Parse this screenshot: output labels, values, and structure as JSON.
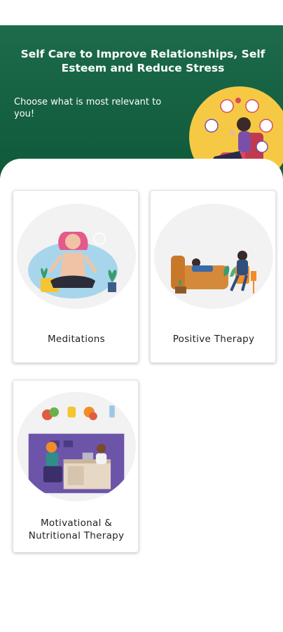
{
  "header": {
    "title": "Self Care to Improve Relationships, Self Esteem and Reduce Stress",
    "subtitle": "Choose what is most relevant to you!",
    "colors": {
      "background": "#0d5838",
      "sun": "#f6c945",
      "chair": "#d94a5c"
    }
  },
  "cards": [
    {
      "label": "Meditations",
      "illustration": "meditation-illustration"
    },
    {
      "label": "Positive Therapy",
      "illustration": "therapy-session-illustration"
    },
    {
      "label": "Motivational & Nutritional Therapy",
      "illustration": "nutrition-consultation-illustration"
    }
  ]
}
